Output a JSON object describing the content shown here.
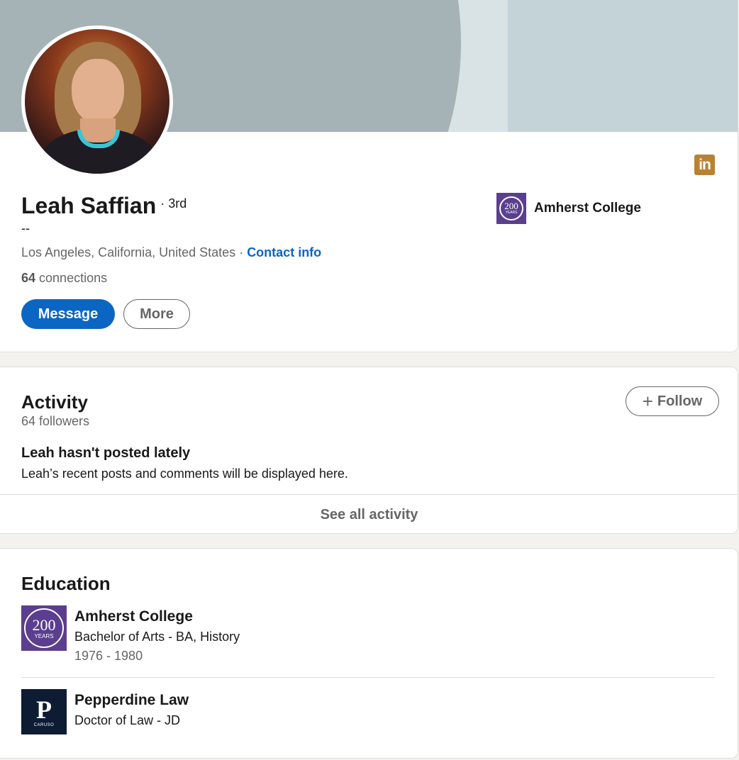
{
  "profile": {
    "name": "Leah Saffian",
    "degree": "· 3rd",
    "headline": "--",
    "location": "Los Angeles, California, United States",
    "location_sep": " · ",
    "contact_link": "Contact info",
    "connections_count": "64",
    "connections_label": " connections",
    "message_button": "Message",
    "more_button": "More",
    "linkedin_badge": "in",
    "top_education": "Amherst College",
    "banner_colors": {
      "base": "#c4d3d7",
      "arc": "#a5b3b6",
      "band": "#d9e3e5"
    }
  },
  "logos": {
    "amherst_number": "200",
    "amherst_sub": "YEARS",
    "pepperdine_letter": "P",
    "pepperdine_sub": "CARUSO"
  },
  "activity": {
    "title": "Activity",
    "followers": "64 followers",
    "follow_button": "Follow",
    "follow_icon": "+",
    "empty_title": "Leah hasn't posted lately",
    "empty_desc": "Leah’s recent posts and comments will be displayed here.",
    "see_all": "See all activity"
  },
  "education": {
    "title": "Education",
    "items": [
      {
        "school": "Amherst College",
        "degree": "Bachelor of Arts - BA, History",
        "years": "1976 - 1980"
      },
      {
        "school": "Pepperdine Law",
        "degree": "Doctor of Law - JD",
        "years": ""
      }
    ]
  },
  "colors": {
    "accent": "#0a66c2",
    "linkedin_badge": "#b98132",
    "amherst_purple": "#5b3e8f",
    "pepperdine_navy": "#0d1b33",
    "page_bg": "#f3f2ef"
  }
}
